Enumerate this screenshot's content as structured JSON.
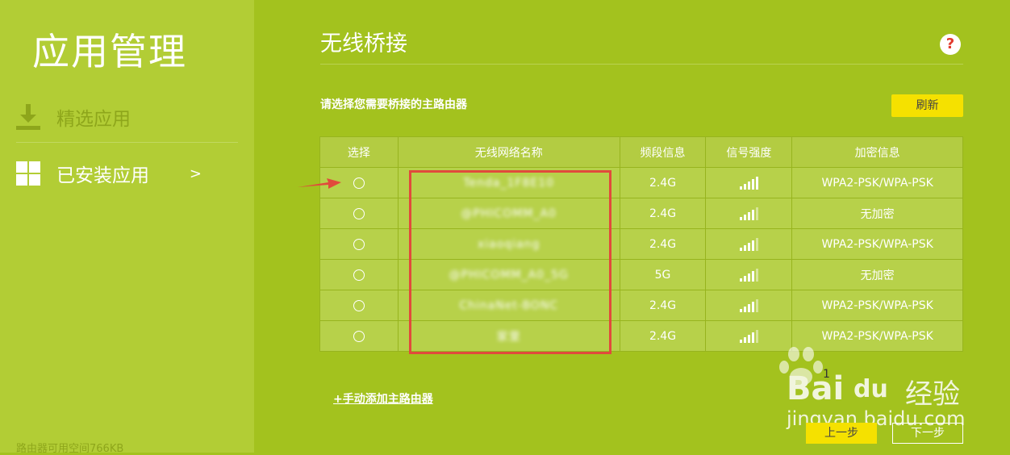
{
  "sidebar": {
    "title": "应用管理",
    "items": [
      {
        "label": "精选应用",
        "icon": "download-icon"
      },
      {
        "label": "已安装应用",
        "icon": "grid-icon",
        "arrow": ">"
      }
    ],
    "storage_text": "路由器可用空间766KB"
  },
  "main": {
    "title": "无线桥接",
    "help_icon": "?",
    "instruction": "请选择您需要桥接的主路由器",
    "refresh_label": "刷新",
    "manual_add_label": "+手动添加主路由器",
    "page_number": "1",
    "prev_label": "上一步",
    "next_label": "下一步"
  },
  "table": {
    "headers": [
      "选择",
      "无线网络名称",
      "频段信息",
      "信号强度",
      "加密信息"
    ],
    "rows": [
      {
        "ssid": "Tenda_1F8E10",
        "band": "2.4G",
        "signal_level": 5,
        "security": "WPA2-PSK/WPA-PSK"
      },
      {
        "ssid": "@PHICOMM_A0",
        "band": "2.4G",
        "signal_level": 4,
        "security": "无加密"
      },
      {
        "ssid": "xiaoqiang",
        "band": "2.4G",
        "signal_level": 4,
        "security": "WPA2-PSK/WPA-PSK"
      },
      {
        "ssid": "@PHICOMM_A0_5G",
        "band": "5G",
        "signal_level": 4,
        "security": "无加密"
      },
      {
        "ssid": "ChinaNet-BONC",
        "band": "2.4G",
        "signal_level": 4,
        "security": "WPA2-PSK/WPA-PSK"
      },
      {
        "ssid": "家里",
        "band": "2.4G",
        "signal_level": 4,
        "security": "WPA2-PSK/WPA-PSK"
      }
    ]
  },
  "watermark": {
    "brand": "Bai",
    "brand2": "du",
    "suffix": "经验",
    "url": "jingyan.baidu.com"
  },
  "colors": {
    "accent_yellow": "#f5e100",
    "highlight_red": "#e14a3c",
    "bg_green": "#a3c21e",
    "sidebar_green": "#b2cd35"
  }
}
